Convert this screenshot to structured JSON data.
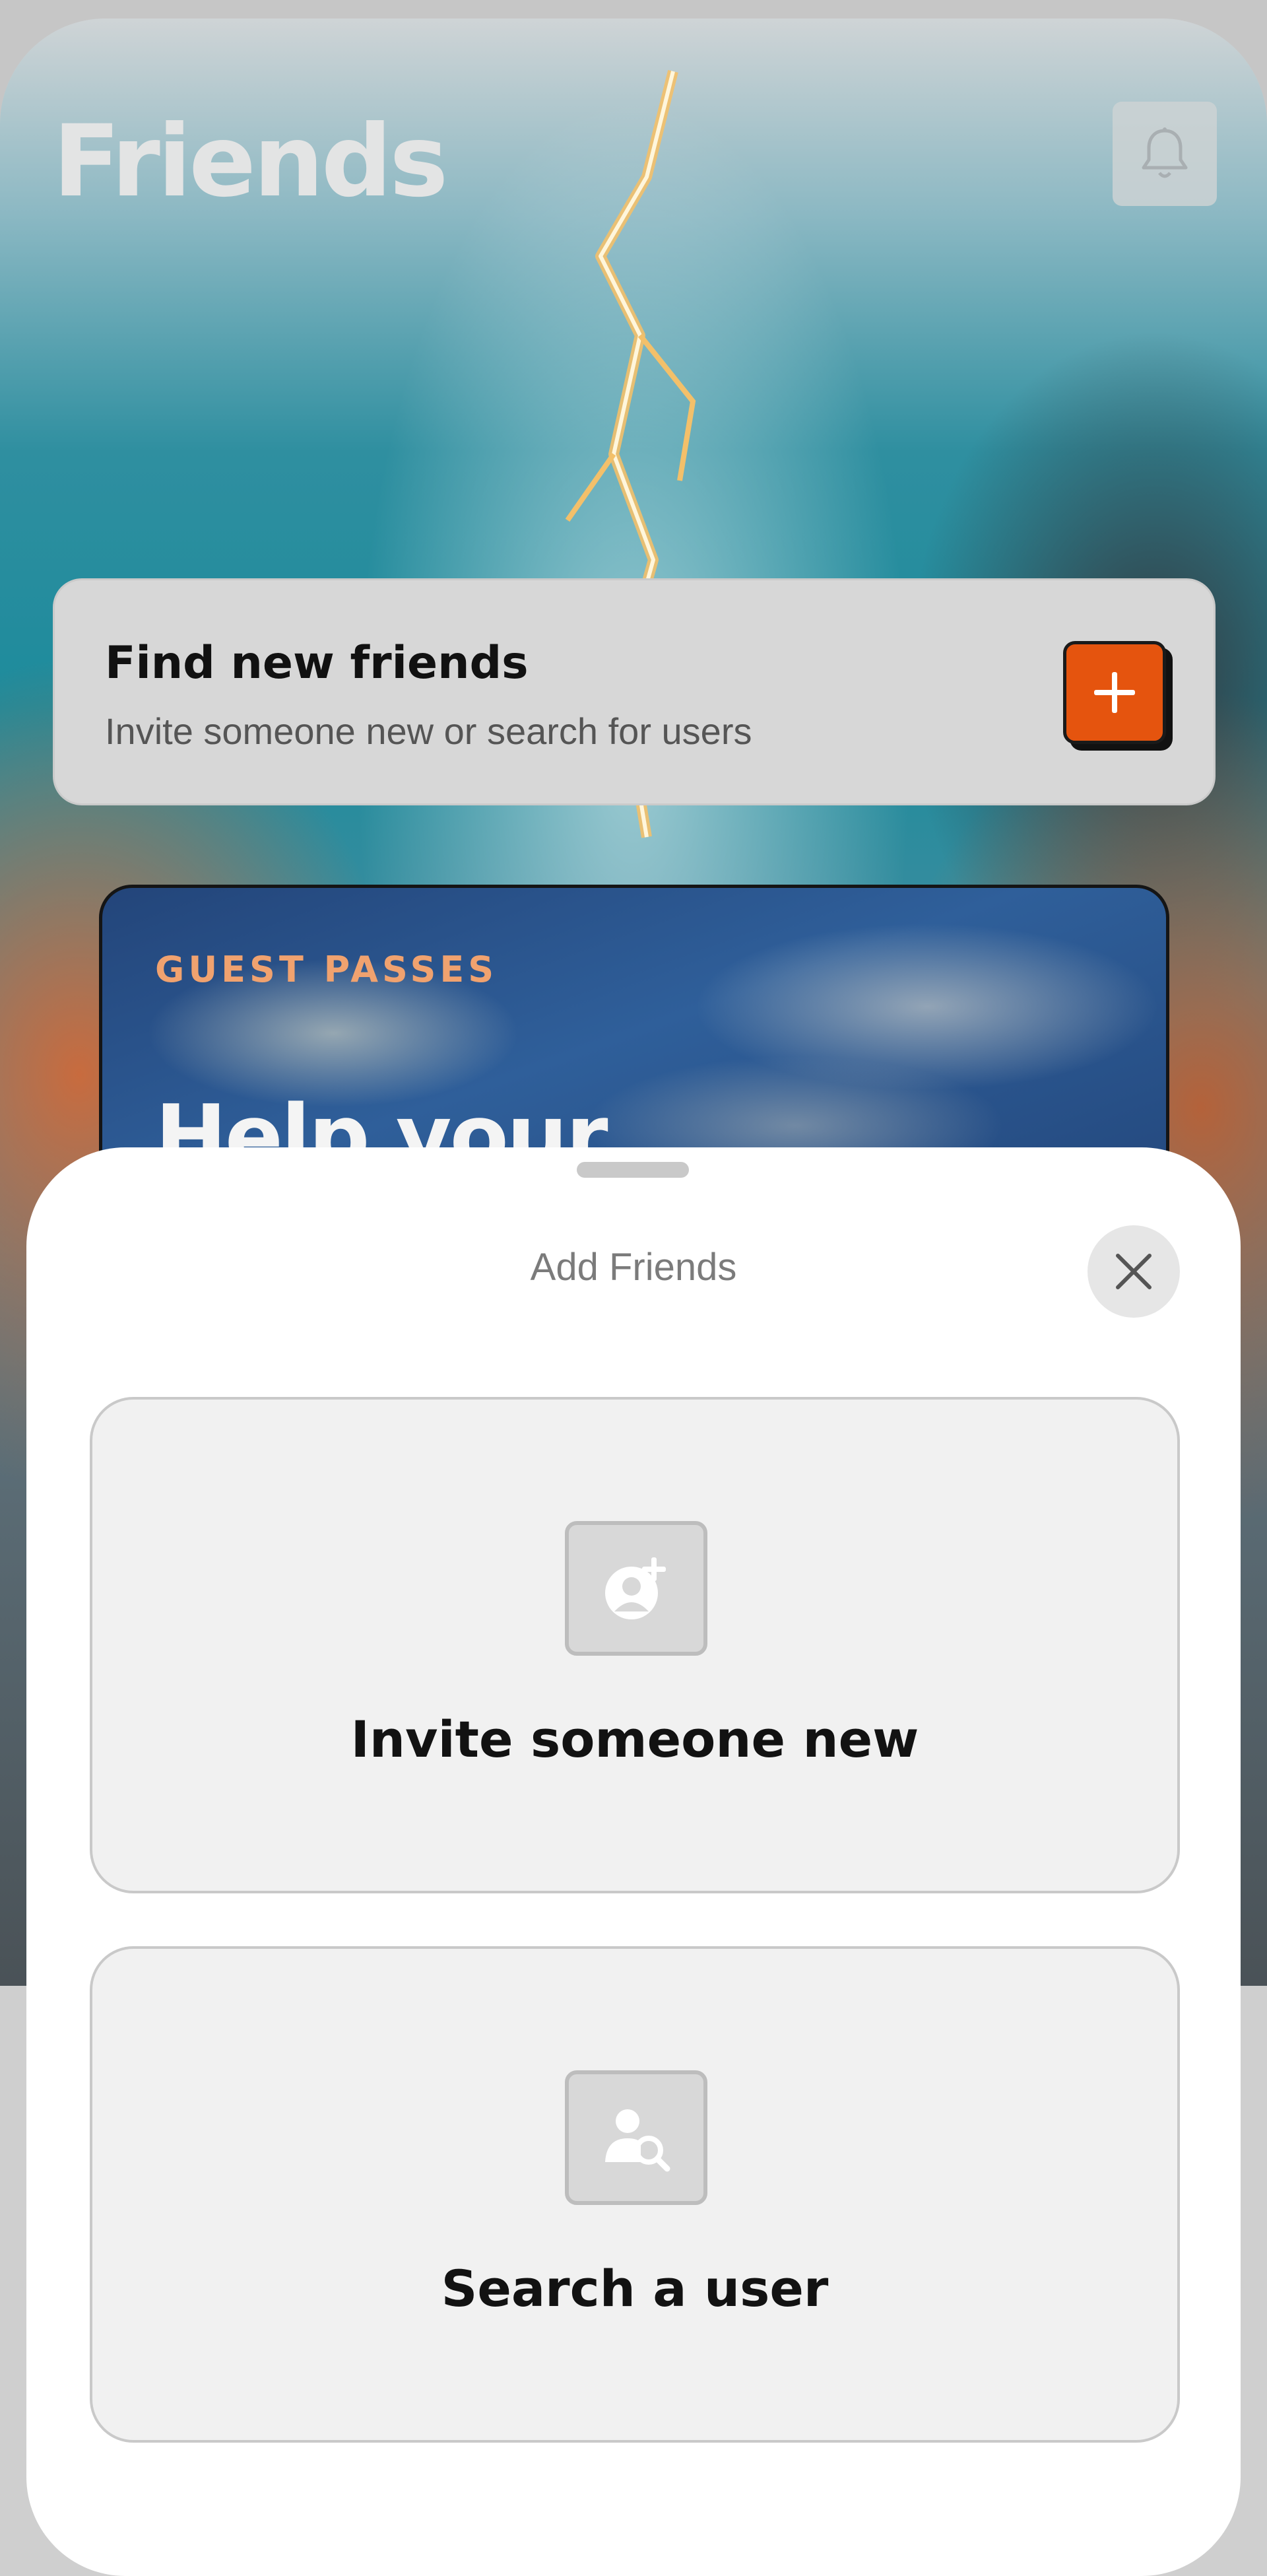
{
  "header": {
    "title": "Friends",
    "notifications_icon": "bell-icon"
  },
  "find_card": {
    "title": "Find new friends",
    "subtitle": "Invite someone new or search for users",
    "add_icon": "plus-icon",
    "accent_color": "#E5540E"
  },
  "guest_passes": {
    "label": "GUEST PASSES",
    "heading": "Help your",
    "label_color": "#F0A26F"
  },
  "sheet": {
    "title": "Add Friends",
    "close_icon": "close-icon",
    "options": [
      {
        "label": "Invite someone new",
        "icon": "user-plus-icon"
      },
      {
        "label": "Search a user",
        "icon": "user-search-icon"
      }
    ]
  }
}
